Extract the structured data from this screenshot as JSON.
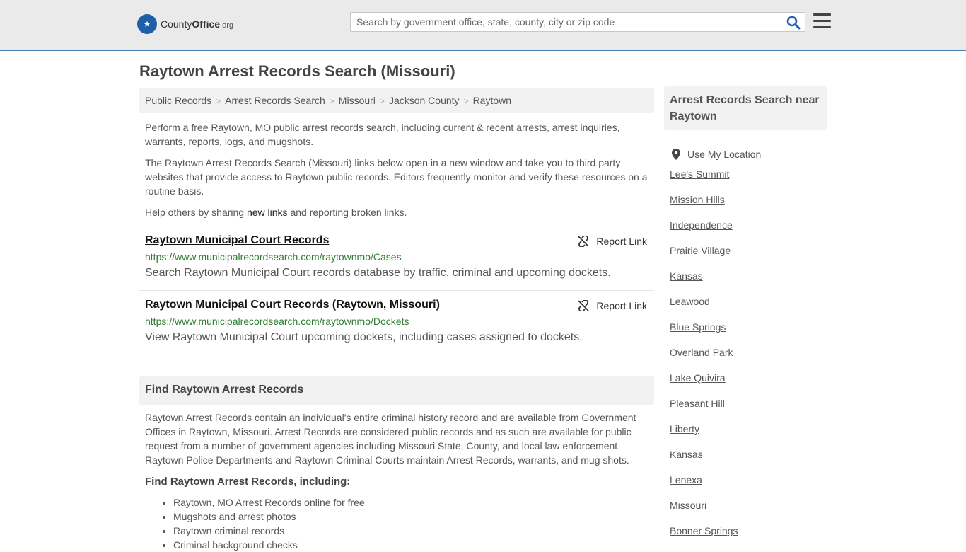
{
  "header": {
    "logo_main": "County",
    "logo_bold": "Office",
    "logo_org": ".org",
    "search_placeholder": "Search by government office, state, county, city or zip code"
  },
  "page": {
    "title": "Raytown Arrest Records Search (Missouri)"
  },
  "breadcrumb": [
    "Public Records",
    "Arrest Records Search",
    "Missouri",
    "Jackson County",
    "Raytown"
  ],
  "intro": {
    "p1": "Perform a free Raytown, MO public arrest records search, including current & recent arrests, arrest inquiries, warrants, reports, logs, and mugshots.",
    "p2": "The Raytown Arrest Records Search (Missouri) links below open in a new window and take you to third party websites that provide access to Raytown public records. Editors frequently monitor and verify these resources on a routine basis.",
    "p3_before": "Help others by sharing ",
    "p3_link": "new links",
    "p3_after": " and reporting broken links."
  },
  "results": [
    {
      "title": "Raytown Municipal Court Records",
      "url": "https://www.municipalrecordsearch.com/raytownmo/Cases",
      "description": "Search Raytown Municipal Court records database by traffic, criminal and upcoming dockets.",
      "report_label": "Report Link"
    },
    {
      "title": "Raytown Municipal Court Records (Raytown, Missouri)",
      "url": "https://www.municipalrecordsearch.com/raytownmo/Dockets",
      "description": "View Raytown Municipal Court upcoming dockets, including cases assigned to dockets.",
      "report_label": "Report Link"
    }
  ],
  "find_section": {
    "heading": "Find Raytown Arrest Records",
    "paragraph": "Raytown Arrest Records contain an individual's entire criminal history record and are available from Government Offices in Raytown, Missouri. Arrest Records are considered public records and as such are available for public request from a number of government agencies including Missouri State, County, and local law enforcement. Raytown Police Departments and Raytown Criminal Courts maintain Arrest Records, warrants, and mug shots.",
    "subheading": "Find Raytown Arrest Records, including:",
    "items": [
      "Raytown, MO Arrest Records online for free",
      "Mugshots and arrest photos",
      "Raytown criminal records",
      "Criminal background checks"
    ]
  },
  "sidebar": {
    "heading": "Arrest Records Search near Raytown",
    "use_location": "Use My Location",
    "links": [
      "Lee's Summit",
      "Mission Hills",
      "Independence",
      "Prairie Village",
      "Kansas",
      "Leawood",
      "Blue Springs",
      "Overland Park",
      "Lake Quivira",
      "Pleasant Hill",
      "Liberty",
      "Kansas",
      "Lenexa",
      "Missouri",
      "Bonner Springs"
    ]
  }
}
